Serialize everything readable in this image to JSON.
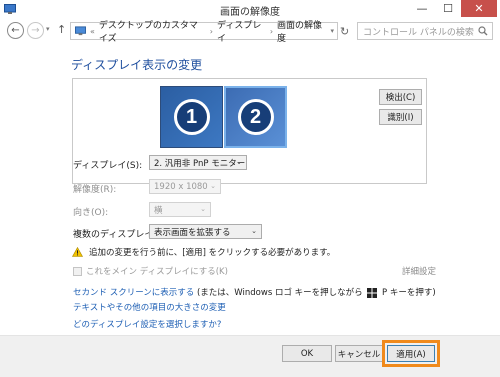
{
  "window": {
    "title": "画面の解像度",
    "minimize_glyph": "—",
    "maximize_glyph": "☐",
    "close_glyph": "✕"
  },
  "nav": {
    "back_glyph": "←",
    "forward_glyph": "→",
    "dropdown_glyph": "▾",
    "up_glyph": "↑",
    "breadcrumb_prefix": "«",
    "breadcrumb": [
      "デスクトップのカスタマイズ",
      "ディスプレイ",
      "画面の解像度"
    ],
    "breadcrumb_sep": "›",
    "chevron_glyph": "▾",
    "refresh_glyph": "↻",
    "search_placeholder": "コントロール パネルの検索"
  },
  "page": {
    "title": "ディスプレイ表示の変更"
  },
  "preview": {
    "monitors": [
      "1",
      "2"
    ],
    "selected_monitor": "2",
    "detect_label": "検出(C)",
    "identify_label": "識別(I)"
  },
  "settings": {
    "display_label": "ディスプレイ(S):",
    "display_value": "2. 汎用非 PnP モニター",
    "resolution_label": "解像度(R):",
    "resolution_value": "1920 x 1080",
    "orientation_label": "向き(O):",
    "orientation_value": "横",
    "multi_label": "複数のディスプレイ(M):",
    "multi_value": "表示画面を拡張する",
    "select_arrow": "⌄"
  },
  "warning": {
    "text": "追加の変更を行う前に、[適用] をクリックする必要があります。"
  },
  "main_display": {
    "checkbox_label": "これをメイン ディスプレイにする(K)",
    "advanced_link": "詳細設定"
  },
  "links": {
    "second_screen_link": "セカンド スクリーンに表示する",
    "second_screen_note_a": " (または、Windows ロゴ キーを押しながら ",
    "second_screen_note_b": " P キーを押す)",
    "text_size_link": "テキストやその他の項目の大きさの変更",
    "which_display_link": "どのディスプレイ設定を選択しますか?"
  },
  "footer": {
    "ok_label": "OK",
    "cancel_label": "キャンセル",
    "apply_label": "適用(A)"
  },
  "colors": {
    "title_blue": "#1e4e9e",
    "link_blue": "#1e5fb4",
    "close_red": "#c7504b",
    "highlight_orange": "#f08a1c",
    "monitor_blue": "#2b5ea2"
  },
  "icons": {
    "app": "monitor-app-icon",
    "address": "control-panel-icon",
    "search": "search-icon",
    "warning": "warning-icon",
    "windows_key": "windows-logo-icon"
  }
}
